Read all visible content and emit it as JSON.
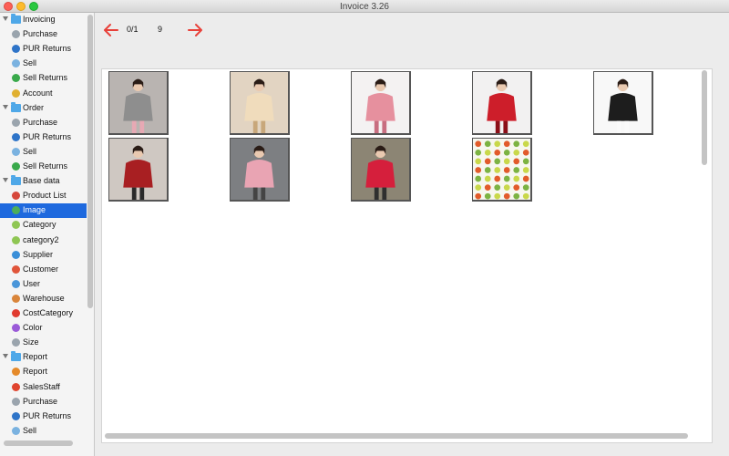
{
  "window": {
    "title": "Invoice 3.26"
  },
  "sidebar": {
    "items": [
      {
        "label": "Invoicing",
        "kind": "group",
        "icon": "folder-icon",
        "color": "#4fa8e8"
      },
      {
        "label": "Purchase",
        "kind": "child",
        "icon": "cart-icon",
        "color": "#9aa4ad"
      },
      {
        "label": "PUR Returns",
        "kind": "child",
        "icon": "globe-icon",
        "color": "#2e74c8"
      },
      {
        "label": "Sell",
        "kind": "child",
        "icon": "coin-icon",
        "color": "#7ab2e0"
      },
      {
        "label": "Sell Returns",
        "kind": "child",
        "icon": "refresh-icon",
        "color": "#39a94b"
      },
      {
        "label": "Account",
        "kind": "child",
        "icon": "coin-icon",
        "color": "#e0b030"
      },
      {
        "label": "Order",
        "kind": "group",
        "icon": "folder-icon",
        "color": "#4fa8e8"
      },
      {
        "label": "Purchase",
        "kind": "child",
        "icon": "cart-icon",
        "color": "#9aa4ad"
      },
      {
        "label": "PUR Returns",
        "kind": "child",
        "icon": "globe-icon",
        "color": "#2e74c8"
      },
      {
        "label": "Sell",
        "kind": "child",
        "icon": "coin-icon",
        "color": "#7ab2e0"
      },
      {
        "label": "Sell Returns",
        "kind": "child",
        "icon": "refresh-icon",
        "color": "#39a94b"
      },
      {
        "label": "Base data",
        "kind": "group",
        "icon": "folder-icon",
        "color": "#4fa8e8"
      },
      {
        "label": "Product List",
        "kind": "child",
        "icon": "boxes-icon",
        "color": "#d6473b"
      },
      {
        "label": "Image",
        "kind": "child",
        "icon": "image-icon",
        "color": "#4cae5a",
        "selected": true
      },
      {
        "label": "Category",
        "kind": "child",
        "icon": "list-icon",
        "color": "#8fc653"
      },
      {
        "label": "category2",
        "kind": "child",
        "icon": "list-icon",
        "color": "#8fc653"
      },
      {
        "label": "Supplier",
        "kind": "child",
        "icon": "people-icon",
        "color": "#3a8fd8"
      },
      {
        "label": "Customer",
        "kind": "child",
        "icon": "customer-icon",
        "color": "#e0553a"
      },
      {
        "label": "User",
        "kind": "child",
        "icon": "user-icon",
        "color": "#4a96d9"
      },
      {
        "label": "Warehouse",
        "kind": "child",
        "icon": "house-icon",
        "color": "#d9853a"
      },
      {
        "label": "CostCategory",
        "kind": "child",
        "icon": "cost-icon",
        "color": "#e03a2f"
      },
      {
        "label": "Color",
        "kind": "child",
        "icon": "palette-icon",
        "color": "#9a5ad8"
      },
      {
        "label": "Size",
        "kind": "child",
        "icon": "size-icon",
        "color": "#9aa4ad"
      },
      {
        "label": "Report",
        "kind": "group",
        "icon": "folder-icon",
        "color": "#4fa8e8"
      },
      {
        "label": "Report",
        "kind": "child",
        "icon": "bar-chart-icon",
        "color": "#e58a2a"
      },
      {
        "label": "SalesStaff",
        "kind": "child",
        "icon": "sales-icon",
        "color": "#e0452f"
      },
      {
        "label": "Purchase",
        "kind": "child",
        "icon": "cart-icon",
        "color": "#9aa4ad"
      },
      {
        "label": "PUR Returns",
        "kind": "child",
        "icon": "globe-icon",
        "color": "#2e74c8"
      },
      {
        "label": "Sell",
        "kind": "child",
        "icon": "coin-icon",
        "color": "#7ab2e0"
      }
    ]
  },
  "toolbar": {
    "page": "0/1",
    "count": "9",
    "prev_icon": "arrow-left-icon",
    "next_icon": "arrow-right-icon",
    "arrow_color": "#e8413a"
  },
  "gallery": {
    "images": [
      {
        "name": "product-image-grey-coat-pink-dress",
        "bg": "#b9b4b1",
        "main": "#8e8e8e",
        "accent": "#e7a9b4"
      },
      {
        "name": "product-image-lace-blouse",
        "bg": "#e2d4c2",
        "main": "#f0dcbc",
        "accent": "#c8a77a"
      },
      {
        "name": "product-image-pink-puffer-jacket",
        "bg": "#f4f2f2",
        "main": "#e6909e",
        "accent": "#c86e80"
      },
      {
        "name": "product-image-red-puffer-jacket",
        "bg": "#f2f1f1",
        "main": "#cd1e2a",
        "accent": "#8b0f18"
      },
      {
        "name": "product-image-black-white-tops",
        "bg": "#f8f8f8",
        "main": "#1d1d1d",
        "accent": "#fafafa"
      },
      {
        "name": "product-image-red-sweater",
        "bg": "#cfc8c2",
        "main": "#a81f22",
        "accent": "#2a2a2a"
      },
      {
        "name": "product-image-pink-dress",
        "bg": "#7d7f82",
        "main": "#e9a4b3",
        "accent": "#444444"
      },
      {
        "name": "product-image-red-jacket-street",
        "bg": "#8c8574",
        "main": "#d51f3c",
        "accent": "#2f2f2f"
      },
      {
        "name": "product-image-vegetables-grid",
        "bg": "#f7f7ef",
        "main": "#7cb342",
        "accent": "#e25b2a"
      }
    ]
  }
}
